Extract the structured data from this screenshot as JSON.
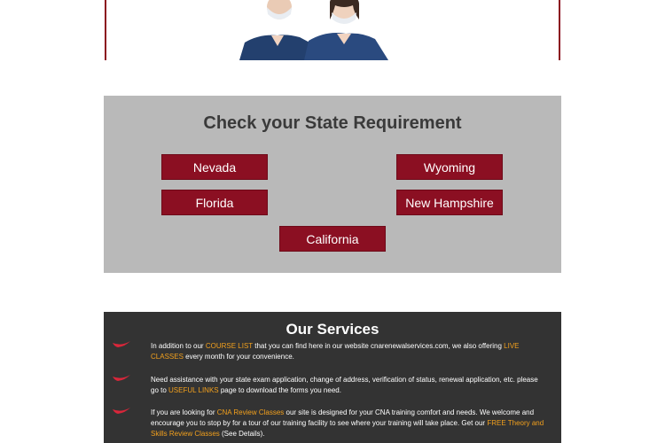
{
  "state_section": {
    "title": "Check your State Requirement",
    "buttons": [
      "Nevada",
      "Wyoming",
      "Florida",
      "New Hampshire",
      "California"
    ]
  },
  "services": {
    "title": "Our Services",
    "items": [
      {
        "t1": "In addition to our ",
        "l1": "COURSE LIST",
        "t2": " that you can find here in our website cnarenewalservices.com, we also offering ",
        "l2": "LIVE CLASSES",
        "t3": " every month for your convenience."
      },
      {
        "t1": "Need assistance with your state exam application, change of address, verification of status, renewal application, etc. please go to ",
        "l1": "USEFUL LINKS",
        "t2": " page to download the forms you need."
      },
      {
        "t1": "If you are looking for ",
        "l1": "CNA Review Classes",
        "t2": " our site is designed for your CNA training comfort and needs. We welcome and encourage you to stop by for a tour of our training facility to see where your training will take place. Get our ",
        "l2": "FREE Theory and Skills Review Classes",
        "t3": " (See Details)."
      }
    ]
  },
  "colors": {
    "accent": "#8b0f22",
    "link": "#f2a01d",
    "panel": "#b9b9b9",
    "dark": "#333333"
  }
}
